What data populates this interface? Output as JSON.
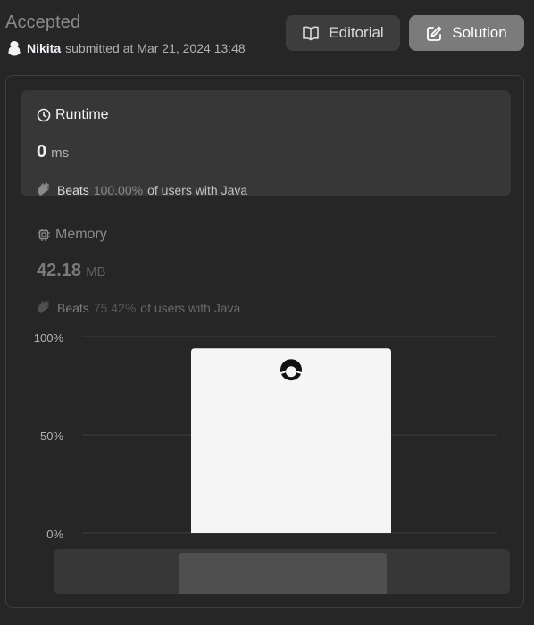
{
  "header": {
    "status": "Accepted",
    "user": "Nikita",
    "submitted_text": "submitted at Mar 21, 2024 13:48",
    "editorial_label": "Editorial",
    "solution_label": "Solution"
  },
  "runtime": {
    "title": "Runtime",
    "value": "0",
    "unit": "ms",
    "beats_label": "Beats",
    "beats_pct": "100.00%",
    "beats_rest": "of users with Java"
  },
  "memory": {
    "title": "Memory",
    "value": "42.18",
    "unit": "MB",
    "beats_label": "Beats",
    "beats_pct": "75.42%",
    "beats_rest": "of users with Java"
  },
  "chart_data": {
    "type": "bar",
    "yticks": [
      "100%",
      "50%",
      "0%"
    ],
    "ylim": [
      0,
      100
    ],
    "values": [
      94
    ],
    "grid": true,
    "colors": {
      "bar": "#f5f5f5",
      "grid": "#3e3e3e",
      "tick": "#b3b3b3",
      "slider_track": "#373737",
      "slider_thumb": "#4f4f4f"
    }
  }
}
